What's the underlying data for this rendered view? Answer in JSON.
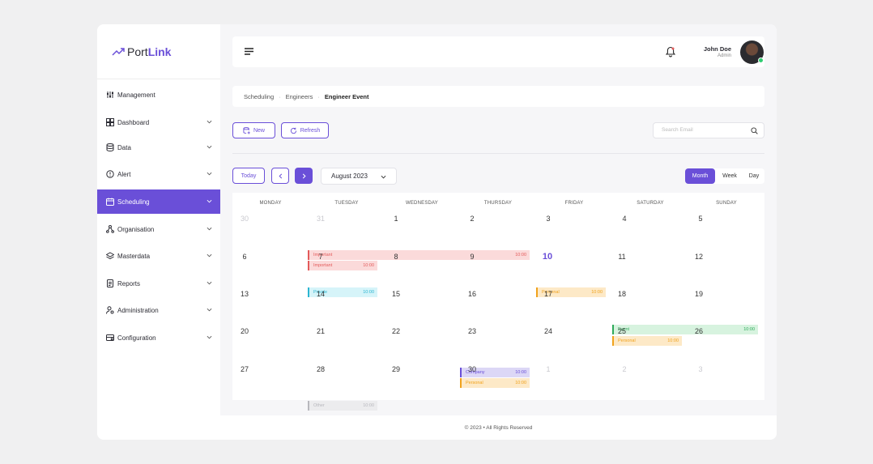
{
  "brand": {
    "name_plain": "Port",
    "name_bold": "Link"
  },
  "sidebar": {
    "items": [
      {
        "label": "Management",
        "icon": "sliders-icon"
      },
      {
        "label": "Dashboard",
        "icon": "grid-icon"
      },
      {
        "label": "Data",
        "icon": "database-icon"
      },
      {
        "label": "Alert",
        "icon": "alert-icon"
      },
      {
        "label": "Scheduling",
        "icon": "calendar-icon",
        "active": true
      },
      {
        "label": "Organisation",
        "icon": "org-icon"
      },
      {
        "label": "Masterdata",
        "icon": "layers-icon"
      },
      {
        "label": "Reports",
        "icon": "report-icon"
      },
      {
        "label": "Administration",
        "icon": "admin-icon"
      },
      {
        "label": "Configuration",
        "icon": "config-icon"
      }
    ]
  },
  "header": {
    "user_name": "John Doe",
    "user_role": "Admin"
  },
  "breadcrumb": {
    "items": [
      "Scheduling",
      "Engineers"
    ],
    "current": "Engineer Event"
  },
  "toolbar": {
    "new_label": "New",
    "refresh_label": "Refresh",
    "search_placeholder": "Search Email"
  },
  "calendar_controls": {
    "today_label": "Today",
    "month_value": "August 2023",
    "views": [
      "Month",
      "Week",
      "Day"
    ],
    "active_view": "Month"
  },
  "calendar": {
    "weekdays": [
      "MONDAY",
      "TUESDAY",
      "WEDNESDAY",
      "THURSDAY",
      "FRIDAY",
      "SATURDAY",
      "SUNDAY"
    ],
    "weeks": [
      [
        "30",
        "31",
        "1",
        "2",
        "3",
        "4",
        "5"
      ],
      [
        "6",
        "7",
        "8",
        "9",
        "10",
        "11",
        "12"
      ],
      [
        "13",
        "14",
        "15",
        "16",
        "17",
        "18",
        "19"
      ],
      [
        "20",
        "21",
        "22",
        "23",
        "24",
        "25",
        "26"
      ],
      [
        "27",
        "28",
        "29",
        "30",
        "1",
        "2",
        "3"
      ]
    ],
    "events": [
      {
        "label": "Important",
        "time": "10:00",
        "type": "important"
      },
      {
        "label": "Important",
        "time": "10:00",
        "type": "important"
      },
      {
        "label": "Private",
        "time": "10:00",
        "type": "private"
      },
      {
        "label": "Personal",
        "time": "10:00",
        "type": "personal"
      },
      {
        "label": "Event",
        "time": "10:00",
        "type": "event"
      },
      {
        "label": "Personal",
        "time": "10:00",
        "type": "personal"
      },
      {
        "label": "Company",
        "time": "10:00",
        "type": "company"
      },
      {
        "label": "Personal",
        "time": "10:00",
        "type": "personal"
      },
      {
        "label": "Other",
        "time": "10:00",
        "type": "other"
      }
    ]
  },
  "footer": {
    "text": "© 2023 • All Rights Reserved"
  },
  "colors": {
    "accent": "#6a4fd8"
  }
}
